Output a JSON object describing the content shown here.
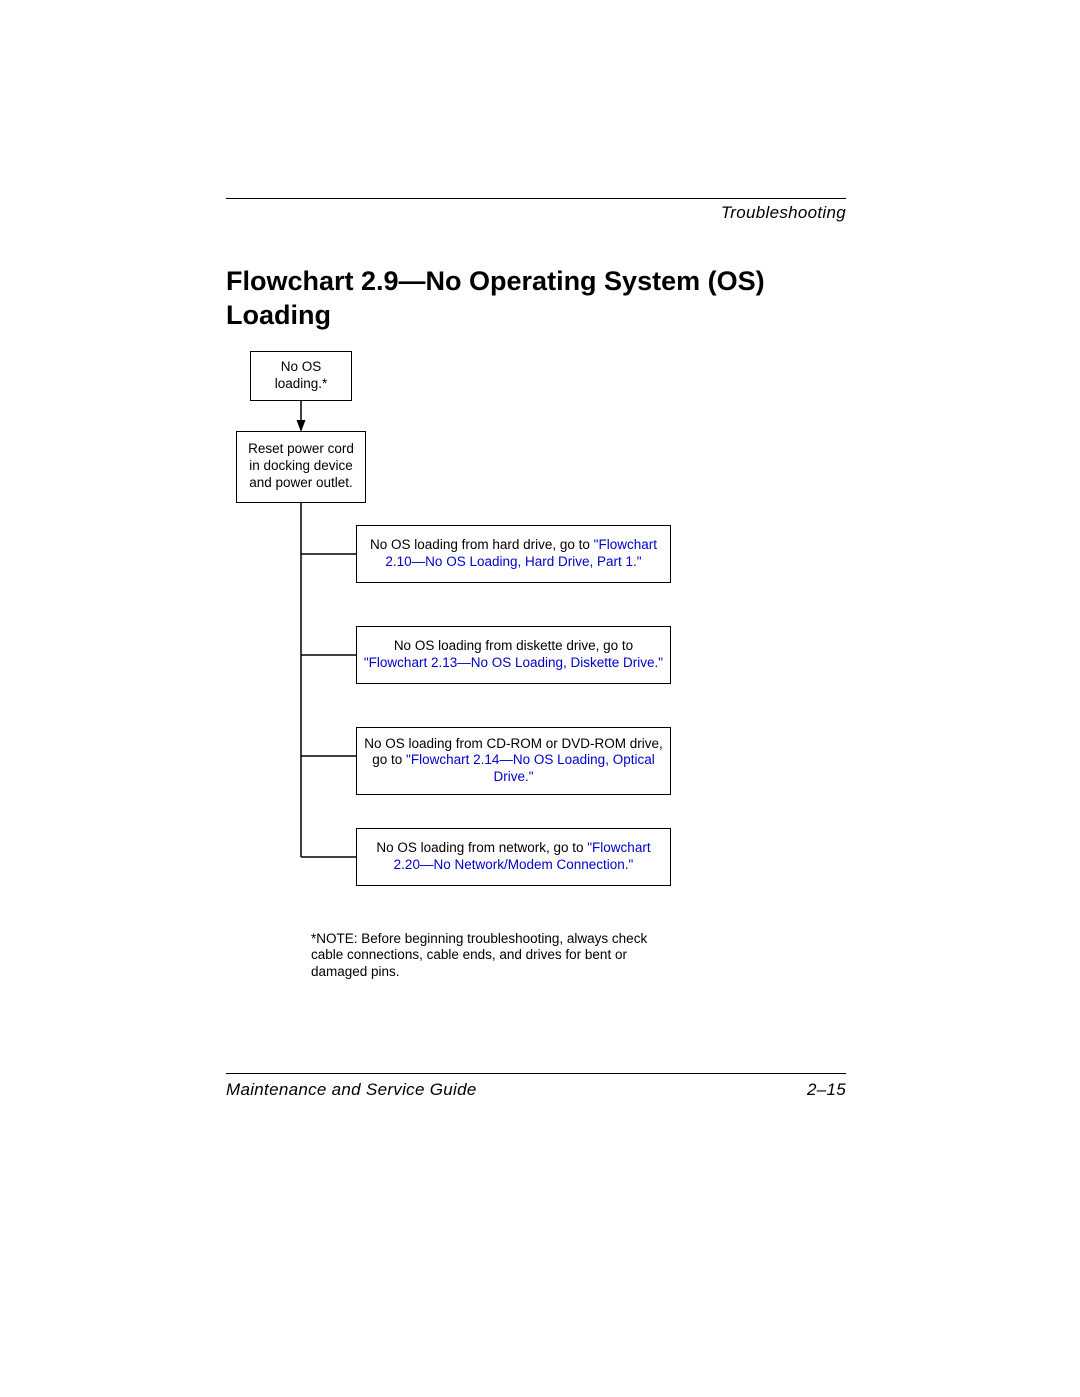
{
  "header": {
    "section": "Troubleshooting"
  },
  "title": "Flowchart 2.9—No Operating System (OS) Loading",
  "flowchart": {
    "start": "No OS loading.*",
    "reset": "Reset power cord in docking device and power outlet.",
    "branches": [
      {
        "text": "No OS loading from hard drive, go to ",
        "link": "\"Flowchart 2.10—No OS Loading, Hard Drive, Part 1.\""
      },
      {
        "text": "No OS loading from diskette drive, go to ",
        "link": "\"Flowchart 2.13—No OS Loading, Diskette Drive.\""
      },
      {
        "text": "No OS loading from CD-ROM or DVD-ROM drive, go to ",
        "link": "\"Flowchart 2.14—No OS Loading, Optical Drive.\""
      },
      {
        "text": "No OS loading from network, go to ",
        "link": "\"Flowchart 2.20—No Network/Modem Connection.\""
      }
    ],
    "note": "*NOTE: Before beginning troubleshooting, always check cable connections, cable ends, and drives for bent or damaged pins."
  },
  "footer": {
    "guide": "Maintenance and Service Guide",
    "page": "2–15"
  }
}
